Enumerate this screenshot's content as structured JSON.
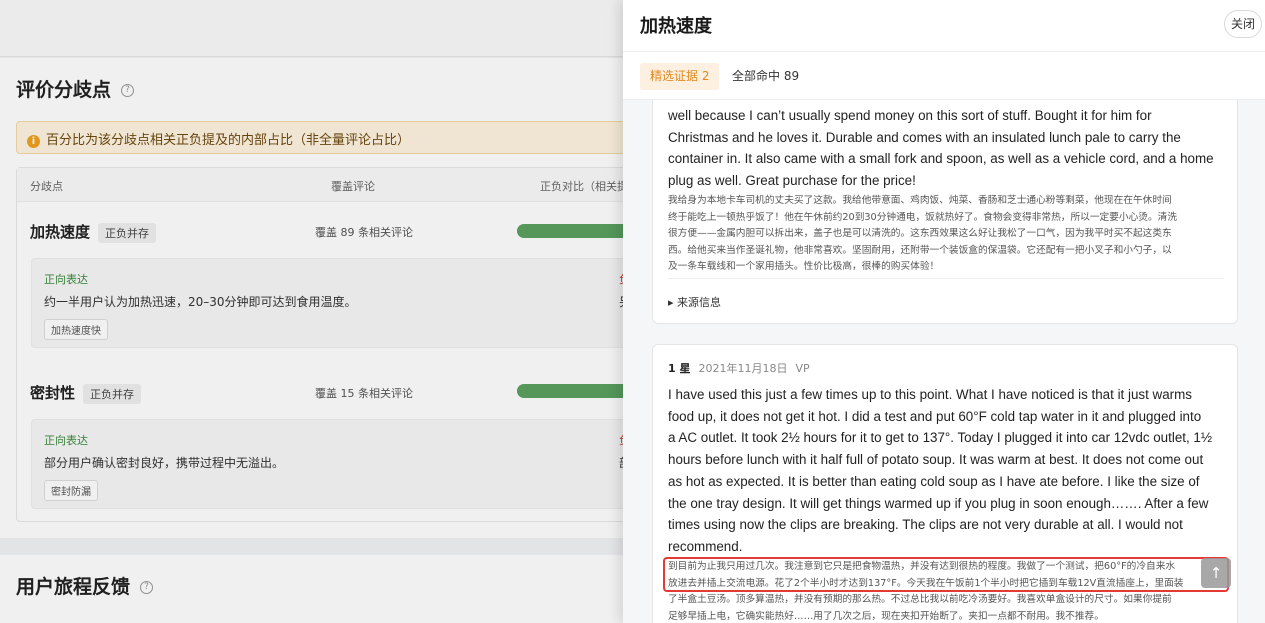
{
  "background": {
    "section_title": "评价分歧点",
    "help_icon": "?",
    "notice": "百分比为该分歧点相关正负提及的内部占比（非全量评论占比）",
    "notice_icon": "i",
    "table_headers": [
      "分歧点",
      "覆盖评论",
      "正负对比（相关提"
    ],
    "rows": [
      {
        "name": "加热速度",
        "tag": "正负并存",
        "coverage": "覆盖 89 条相关评论",
        "positive_label": "正向表达",
        "positive_text": "约一半用户认为加热迅速，20–30分钟即可达到食用温度。",
        "keyword": "加热速度快",
        "neg_fragment": "另"
      },
      {
        "name": "密封性",
        "tag": "正负并存",
        "coverage": "覆盖 15 条相关评论",
        "positive_label": "正向表达",
        "positive_text": "部分用户确认密封良好，携带过程中无溢出。",
        "keyword": "密封防漏",
        "neg_fragment": "部"
      }
    ],
    "section2_title": "用户旅程反馈"
  },
  "drawer": {
    "title": "加热速度",
    "close_label": "关闭",
    "tabs": [
      {
        "label": "精选证据 2",
        "active": true
      },
      {
        "label": "全部命中 89",
        "active": false
      }
    ],
    "reviews": [
      {
        "en_lines": [
          "well because I can’t usually spend money on this sort of stuff. Bought it for him for",
          "Christmas and he loves it. Durable and comes with an insulated lunch pale to carry the",
          "container in. It also came with a small fork and spoon, as well as a vehicle cord, and a home",
          "plug as well. Great purchase for the price!"
        ],
        "zh_lines": [
          "我给身为本地卡车司机的丈夫买了这款。我给他带意面、鸡肉饭、炖菜、香肠和芝士通心粉等剩菜，他现在在午休时间",
          "终于能吃上一顿热乎饭了！他在午休前约20到30分钟通电，饭就热好了。食物会变得非常热，所以一定要小心烫。清洗",
          "很方便——金属内胆可以拆出来，盖子也是可以清洗的。这东西效果这么好让我松了一口气，因为我平时买不起这类东",
          "西。给他买来当作圣诞礼物，他非常喜欢。坚固耐用，还附带一个装饭盒的保温袋。它还配有一把小叉子和小勺子，以",
          "及一条车载线和一个家用插头。性价比极高，很棒的购买体验！"
        ],
        "source_label": "▸ 来源信息"
      },
      {
        "rating": "1 星",
        "date": "2021年11月18日",
        "badge": "VP",
        "en_lines": [
          "I have used this just a few times up to this point. What I have noticed is that it just warms",
          "food up, it does not get it hot. I did a test and put 60°F cold tap water in it and plugged into",
          "a AC outlet. It took 2½ hours for it to get to 137°. Today I plugged it into car 12vdc outlet, 1½",
          "hours before lunch with it half full of potato soup. It was warm at best. It does not come out",
          "as hot as expected. It is better than eating cold soup as I have ate before. I like the size of",
          "the one tray design. It will get things warmed up if you plug in soon enough……. After a few",
          "times using now the clips are breaking. The clips are not very durable at all. I would not",
          "recommend."
        ],
        "zh_lines": [
          "到目前为止我只用过几次。我注意到它只是把食物温热，并没有达到很热的程度。我做了一个测试，把60°F的冷自来水",
          "放进去并插上交流电源。花了2个半小时才达到137°F。今天我在午饭前1个半小时把它插到车载12V直流插座上，里面装",
          "了半盒土豆汤。顶多算温热，并没有预期的那么热。不过总比我以前吃冷汤要好。我喜欢单盒设计的尺寸。如果你提前",
          "足够早插上电，它确实能热好……用了几次之后，现在夹扣开始断了。夹扣一点都不耐用。我不推荐。"
        ]
      }
    ],
    "scroll_top_icon": "↑"
  }
}
